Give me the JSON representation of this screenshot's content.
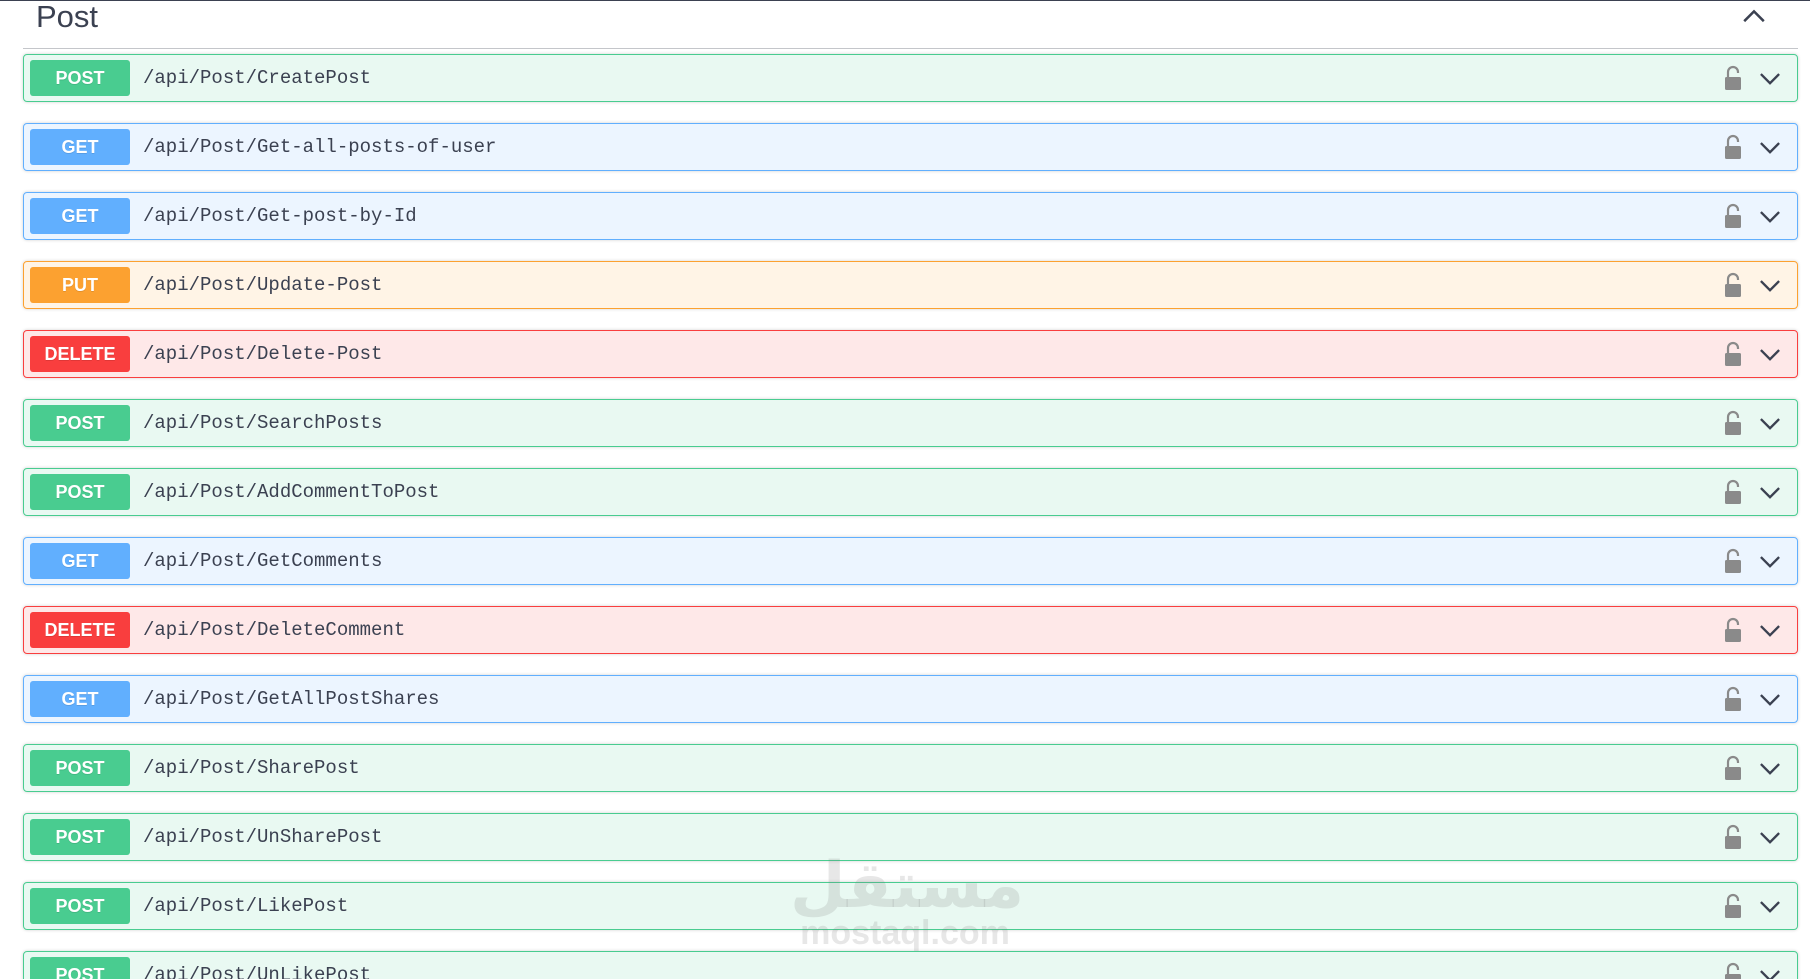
{
  "section": {
    "title": "Post",
    "collapse_icon": "chevron-up-icon"
  },
  "operations": [
    {
      "method": "POST",
      "kind": "post",
      "path": "/api/Post/CreatePost"
    },
    {
      "method": "GET",
      "kind": "get",
      "path": "/api/Post/Get-all-posts-of-user"
    },
    {
      "method": "GET",
      "kind": "get",
      "path": "/api/Post/Get-post-by-Id"
    },
    {
      "method": "PUT",
      "kind": "put",
      "path": "/api/Post/Update-Post"
    },
    {
      "method": "DELETE",
      "kind": "delete",
      "path": "/api/Post/Delete-Post"
    },
    {
      "method": "POST",
      "kind": "post",
      "path": "/api/Post/SearchPosts"
    },
    {
      "method": "POST",
      "kind": "post",
      "path": "/api/Post/AddCommentToPost"
    },
    {
      "method": "GET",
      "kind": "get",
      "path": "/api/Post/GetComments"
    },
    {
      "method": "DELETE",
      "kind": "delete",
      "path": "/api/Post/DeleteComment"
    },
    {
      "method": "GET",
      "kind": "get",
      "path": "/api/Post/GetAllPostShares"
    },
    {
      "method": "POST",
      "kind": "post",
      "path": "/api/Post/SharePost"
    },
    {
      "method": "POST",
      "kind": "post",
      "path": "/api/Post/UnSharePost"
    },
    {
      "method": "POST",
      "kind": "post",
      "path": "/api/Post/LikePost"
    },
    {
      "method": "POST",
      "kind": "post",
      "path": "/api/Post/UnLikePost"
    }
  ],
  "icons": {
    "lock": "lock-icon",
    "expand": "chevron-down-icon"
  },
  "colors": {
    "post": "#49cc90",
    "get": "#61affe",
    "put": "#fca130",
    "delete": "#f93e3e",
    "text": "#3b4151"
  },
  "watermark": {
    "arabic": "مستقل",
    "latin": "mostaql.com"
  }
}
